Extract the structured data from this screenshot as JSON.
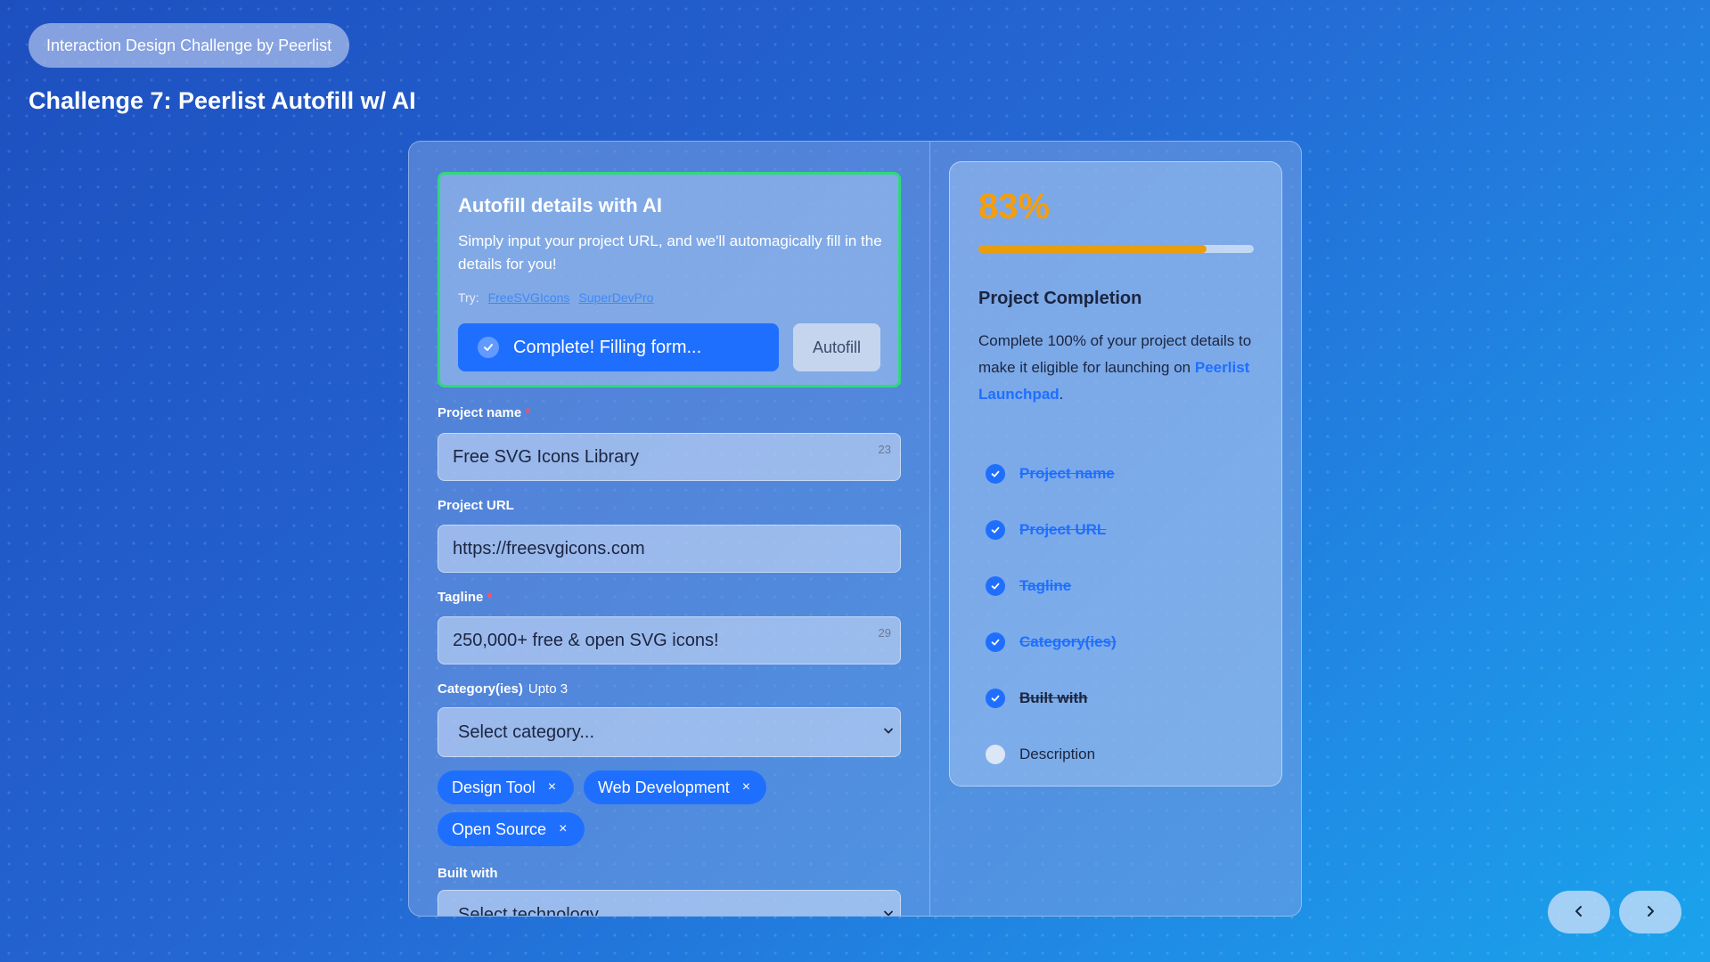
{
  "header": {
    "challenge_chip": "Interaction Design Challenge by Peerlist",
    "title": "Challenge 7: Peerlist Autofill w/ AI"
  },
  "autofill": {
    "title": "Autofill details with AI",
    "description": "Simply input your project URL, and we'll automagically fill in the details for you!",
    "try_label": "Try:",
    "try_links": [
      "FreeSVGIcons",
      "SuperDevPro"
    ],
    "status_text": "Complete! Filling form...",
    "button_label": "Autofill"
  },
  "form": {
    "project_name": {
      "label": "Project name",
      "required": "*",
      "value": "Free SVG Icons Library",
      "counter": "23"
    },
    "project_url": {
      "label": "Project URL",
      "value": "https://freesvgicons.com"
    },
    "tagline": {
      "label": "Tagline",
      "required": "*",
      "value": "250,000+ free & open SVG icons!",
      "counter": "29"
    },
    "categories": {
      "label": "Category(ies)",
      "sublabel": "Upto 3",
      "placeholder": "Select category...",
      "tags": [
        "Design Tool",
        "Web Development",
        "Open Source"
      ],
      "remove_glyph": "×"
    },
    "built_with": {
      "label": "Built with",
      "placeholder": "Select technology..."
    }
  },
  "completion": {
    "percent_label": "83%",
    "progress": 0.83,
    "title": "Project Completion",
    "description": "Complete 100% of your project details to make it eligible for launching on",
    "link_text": "Peerlist Launchpad",
    "period": ".",
    "checklist": [
      {
        "label": "Project name",
        "status": "done"
      },
      {
        "label": "Project URL",
        "status": "done"
      },
      {
        "label": "Tagline",
        "status": "done"
      },
      {
        "label": "Category(ies)",
        "status": "done"
      },
      {
        "label": "Built with",
        "status": "done-dark"
      },
      {
        "label": "Description",
        "status": "todo"
      }
    ]
  },
  "colors": {
    "accent": "#1f6fff",
    "progress": "#ea9e0c",
    "percent": "#f59e0b",
    "success_border": "#2fd97a",
    "required": "#ff4d6d"
  },
  "icons": {
    "status": "check-icon",
    "dropdown": "chevron-down-icon",
    "prev": "chevron-left-icon",
    "next": "chevron-right-icon"
  }
}
